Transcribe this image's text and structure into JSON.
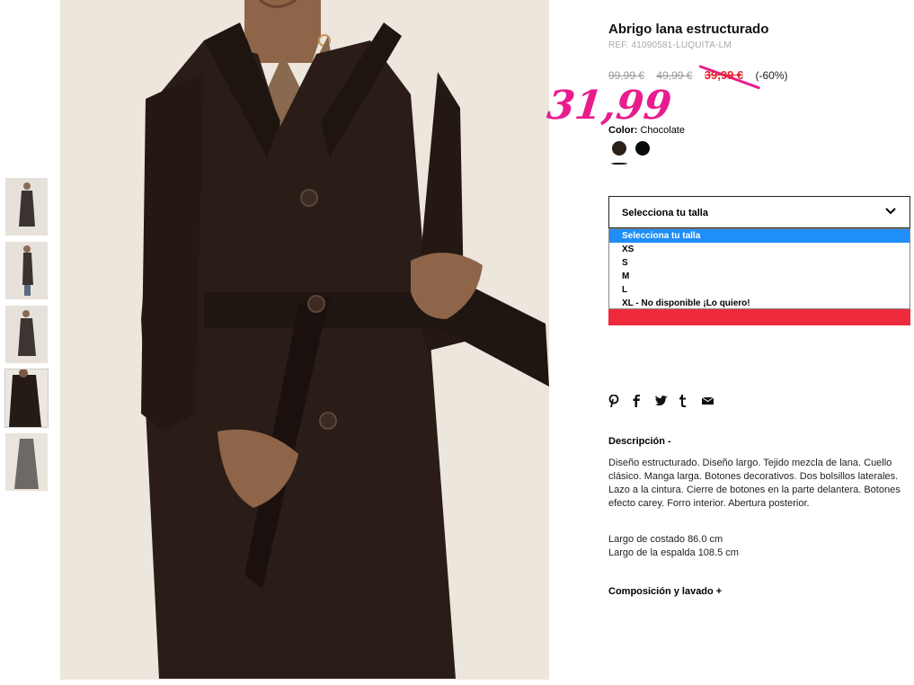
{
  "product": {
    "title": "Abrigo lana estructurado",
    "ref": "REF. 41090581-LUQUITA-LM",
    "price_original": "99,99 €",
    "price_previous": "49,99 €",
    "price_sale": "39,99 €",
    "discount": "(-60%)",
    "handwritten_price": "31,99"
  },
  "color": {
    "label": "Color:",
    "value": "Chocolate",
    "swatches": [
      {
        "name": "Chocolate",
        "hex": "#2b1f1a"
      },
      {
        "name": "Negro",
        "hex": "#0a0a0a"
      }
    ]
  },
  "size": {
    "placeholder": "Selecciona tu talla",
    "options": [
      "Selecciona tu talla",
      "XS",
      "S",
      "M",
      "L",
      "XL - No disponible ¡Lo quiero!"
    ]
  },
  "social": [
    "pinterest-icon",
    "facebook-icon",
    "twitter-icon",
    "tumblr-icon",
    "email-icon"
  ],
  "description": {
    "heading": "Descripción  -",
    "text": "Diseño estructurado. Diseño largo. Tejido mezcla de lana. Cuello clásico. Manga larga. Botones decorativos. Dos bolsillos laterales. Lazo a la cintura. Cierre de botones en la parte delantera. Botones efecto carey. Forro interior. Abertura posterior.",
    "measure1": "Largo de costado 86.0 cm",
    "measure2": "Largo de la espalda 108.5 cm"
  },
  "composition": {
    "heading": "Composición y lavado  +"
  },
  "colors": {
    "accent_red": "#e3252c",
    "annotation_pink": "#e91c8d",
    "select_highlight": "#1f8ef7"
  }
}
